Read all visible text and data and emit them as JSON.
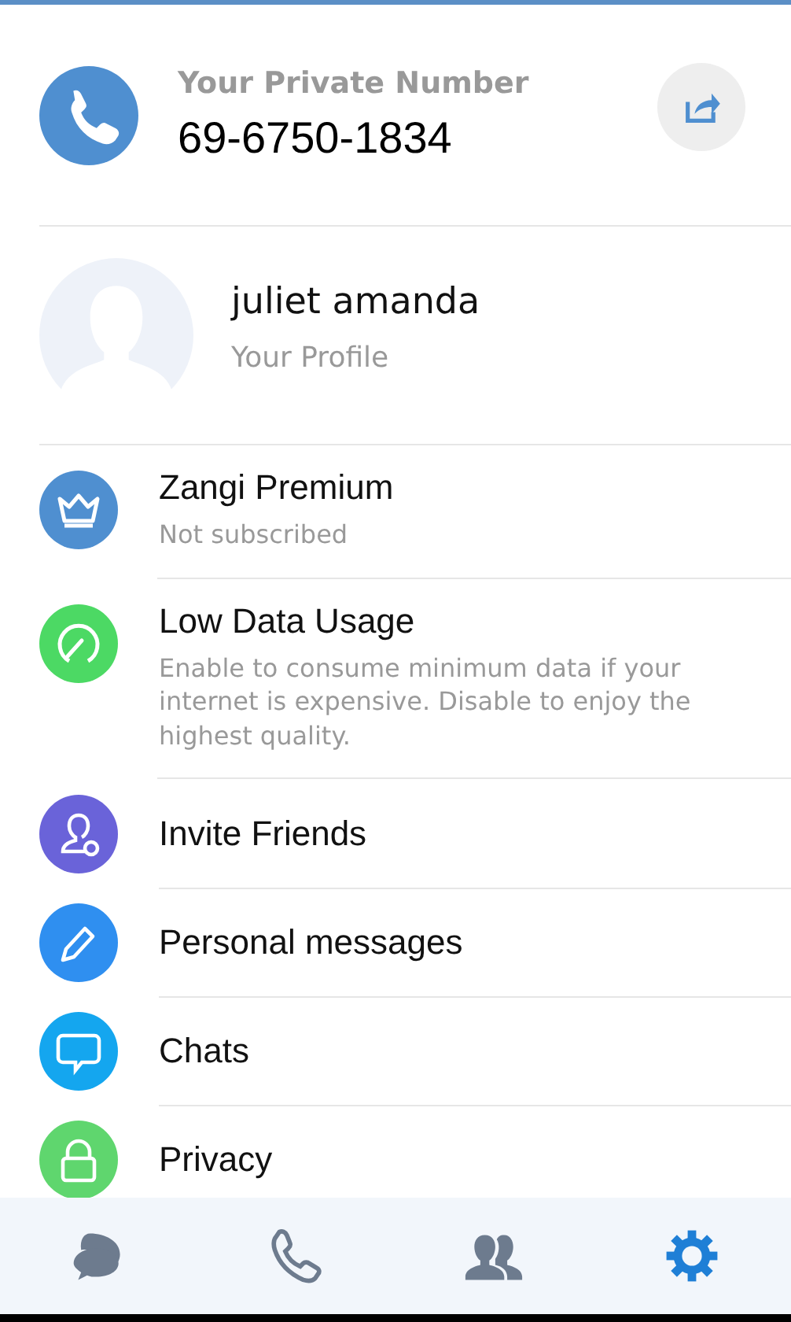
{
  "private_number": {
    "label": "Your Private Number",
    "number": "69-6750-1834"
  },
  "profile": {
    "name": "juliet amanda",
    "subtitle": "Your Profile"
  },
  "menu": [
    {
      "kind": "crown",
      "color": "#4f8fd0",
      "title": "Zangi Premium",
      "subtitle": "Not subscribed"
    },
    {
      "kind": "gauge",
      "color": "#4cd964",
      "title": "Low Data Usage",
      "subtitle": "Enable to consume minimum data if your internet is expensive. Disable to enjoy the highest quality."
    },
    {
      "kind": "invite",
      "color": "#6a63d9",
      "title": "Invite Friends"
    },
    {
      "kind": "pencil",
      "color": "#2f8ff0",
      "title": "Personal messages"
    },
    {
      "kind": "chat",
      "color": "#14a6ef",
      "title": "Chats"
    },
    {
      "kind": "lock",
      "color": "#5fd66e",
      "title": "Privacy"
    }
  ],
  "nav": [
    {
      "kind": "chats",
      "selected": false
    },
    {
      "kind": "calls",
      "selected": false
    },
    {
      "kind": "contacts",
      "selected": false
    },
    {
      "kind": "settings",
      "selected": true
    }
  ]
}
